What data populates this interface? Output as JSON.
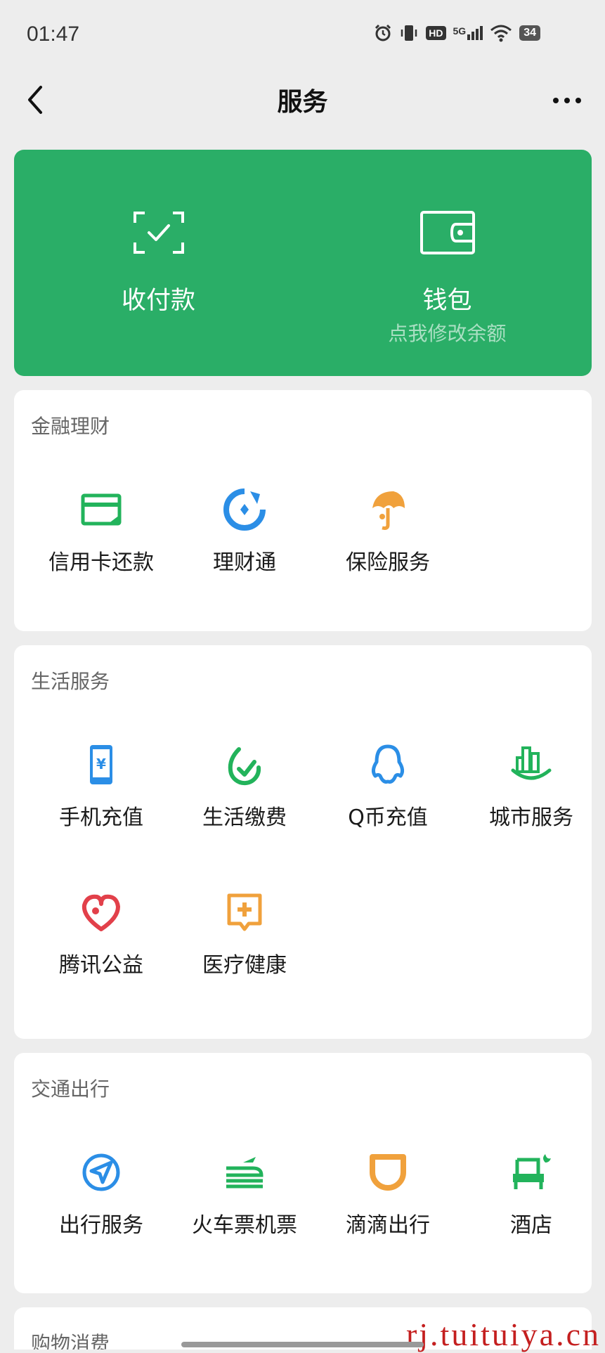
{
  "status_bar": {
    "time": "01:47",
    "network": "5G",
    "hd": "HD",
    "battery": "34"
  },
  "header": {
    "title": "服务"
  },
  "hero": {
    "pay": {
      "label": "收付款"
    },
    "wallet": {
      "label": "钱包",
      "sub": "点我修改余额"
    }
  },
  "sections": {
    "finance": {
      "title": "金融理财",
      "items": [
        {
          "label": "信用卡还款"
        },
        {
          "label": "理财通"
        },
        {
          "label": "保险服务"
        }
      ]
    },
    "life": {
      "title": "生活服务",
      "items": [
        {
          "label": "手机充值"
        },
        {
          "label": "生活缴费"
        },
        {
          "label": "Q币充值"
        },
        {
          "label": "城市服务"
        },
        {
          "label": "腾讯公益"
        },
        {
          "label": "医疗健康"
        }
      ]
    },
    "transport": {
      "title": "交通出行",
      "items": [
        {
          "label": "出行服务"
        },
        {
          "label": "火车票机票"
        },
        {
          "label": "滴滴出行"
        },
        {
          "label": "酒店"
        }
      ]
    },
    "shopping": {
      "title": "购物消费"
    }
  },
  "watermark": "rj.tuituiya.cn",
  "colors": {
    "brand_green": "#2aae67",
    "blue": "#2b8ee6",
    "orange": "#f0a13c",
    "red": "#e2404a",
    "green": "#22b35b"
  }
}
